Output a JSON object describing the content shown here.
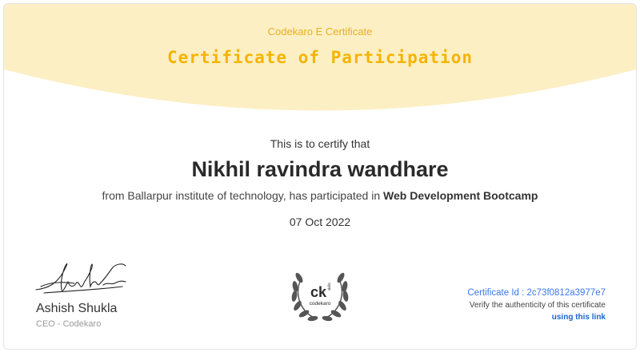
{
  "header": {
    "brand_line": "Codekaro E Certificate",
    "title": "Certificate of Participation",
    "banner_color": "#fcefc4",
    "title_color": "#f4b400"
  },
  "body": {
    "certify_text": "This is to certify that",
    "recipient_name": "Nikhil ravindra wandhare",
    "from_prefix": "from Ballarpur institute of technology, has participated in ",
    "program_name": "Web Development Bootcamp",
    "date": "07 Oct 2022"
  },
  "signatory": {
    "name": "Ashish Shukla",
    "role": "CEO - Codekaro",
    "signature_icon": "handwritten-signature"
  },
  "logo": {
    "icon": "laurel-wreath-logo",
    "text_main": "ck",
    "text_sub": "codekaro",
    "text_side": "skills"
  },
  "verification": {
    "certificate_id": "Certificate Id : 2c73f0812a3977e7",
    "verify_text": "Verify the authenticity of this certificate",
    "link_text": "using this link",
    "link_color": "#1a66d2"
  }
}
